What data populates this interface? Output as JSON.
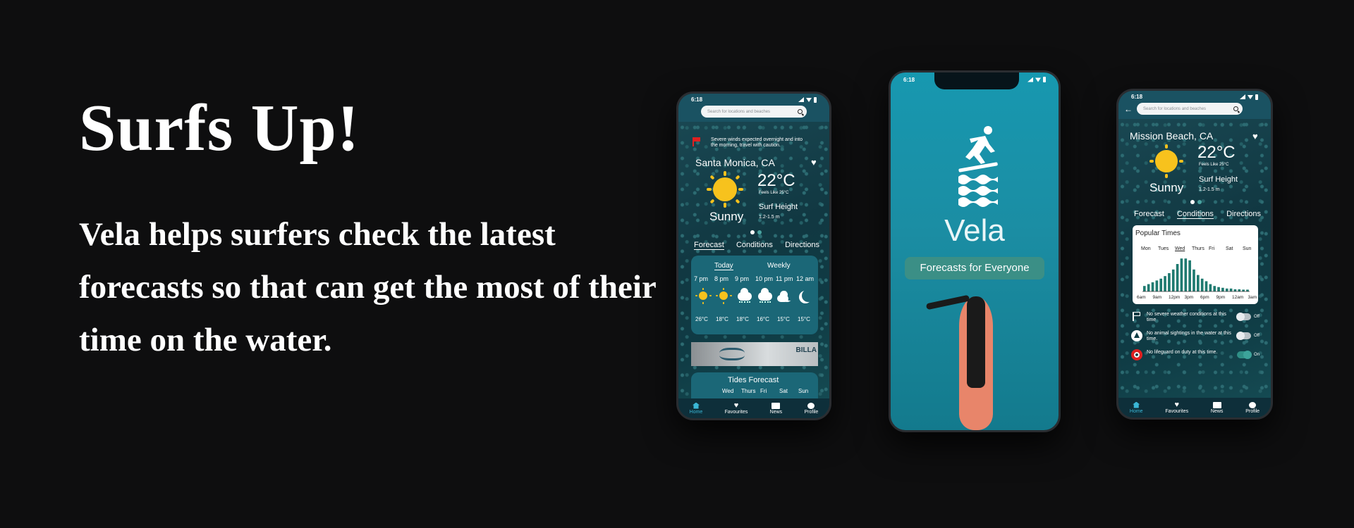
{
  "hero": {
    "title": "Surfs Up!",
    "body": "Vela helps surfers check the latest forecasts so that can get the most of their time on the water."
  },
  "colors": {
    "background": "#0e0e0f",
    "accent_teal": "#1b6777",
    "sun_yellow": "#f7c21d",
    "alert_red": "#e02020"
  },
  "status": {
    "time": "6:18"
  },
  "search": {
    "placeholder": "Search for locations and beaches"
  },
  "left_phone": {
    "alert": "Severe winds expected overnight and into the morning, travel with caution.",
    "location": "Santa Monica, CA",
    "temp": "22°C",
    "feels": "Feels Like 25°C",
    "condition": "Sunny",
    "surf_label": "Surf Height",
    "surf_value": "1.2-1.5 m",
    "tabs": [
      "Forecast",
      "Conditions",
      "Directions"
    ],
    "period_tabs": [
      "Today",
      "Weekly"
    ],
    "hours": [
      "7 pm",
      "8 pm",
      "9 pm",
      "10 pm",
      "11 pm",
      "12 am"
    ],
    "hour_icons": [
      "sun-icon",
      "sun-icon",
      "cloud-rain-icon",
      "cloud-rain-icon",
      "moon-cloud-icon",
      "moon-icon"
    ],
    "temps": [
      "26°C",
      "18°C",
      "18°C",
      "16°C",
      "15°C",
      "15°C"
    ],
    "tides_title": "Tides Forecast",
    "tide_days": [
      "Wed",
      "Thurs",
      "Fri",
      "Sat",
      "Sun"
    ],
    "ad_text": "BILLA"
  },
  "center_phone": {
    "brand": "Vela",
    "tagline": "Forecasts for Everyone"
  },
  "right_phone": {
    "location": "Mission Beach, CA",
    "temp": "22°C",
    "feels": "Feels Like 25°C",
    "condition": "Sunny",
    "surf_label": "Surf Height",
    "surf_value": "1.2-1.5 m",
    "tabs": [
      "Forecast",
      "Conditions",
      "Directions"
    ],
    "popular_title": "Popular Times",
    "days": [
      "Mon",
      "Tues",
      "Wed",
      "Thurs",
      "Fri",
      "Sat",
      "Sun"
    ],
    "time_labels": [
      "6am",
      "9am",
      "12pm",
      "3pm",
      "6pm",
      "9pm",
      "12am",
      "3am"
    ],
    "bar_levels": [
      0.15,
      0.2,
      0.25,
      0.3,
      0.35,
      0.42,
      0.5,
      0.6,
      0.75,
      0.9,
      0.9,
      0.85,
      0.6,
      0.45,
      0.35,
      0.28,
      0.2,
      0.15,
      0.12,
      0.1,
      0.08,
      0.08,
      0.06,
      0.06,
      0.05,
      0.05
    ],
    "notices": [
      {
        "icon": "flag-icon",
        "text": "No severe weather conditions at this time",
        "state": "Off"
      },
      {
        "icon": "shark-icon",
        "text": "No animal sightings in the water at this time.",
        "state": "Off"
      },
      {
        "icon": "lifebuoy-icon",
        "text": "No lifeguard on duty at this time.",
        "state": "On"
      }
    ]
  },
  "nav": [
    "Home",
    "Favourites",
    "News",
    "Profile"
  ]
}
